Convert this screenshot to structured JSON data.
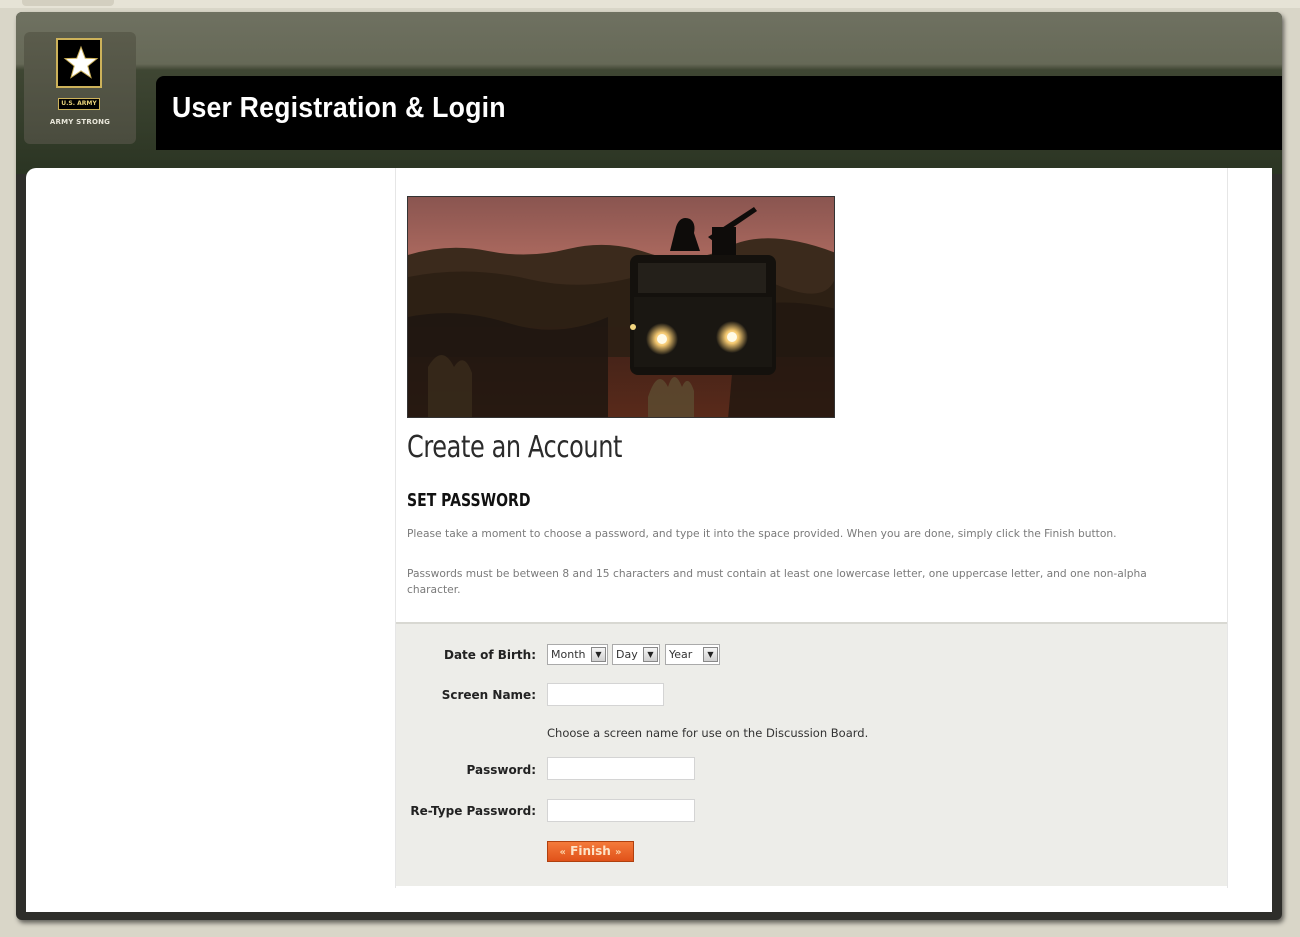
{
  "header": {
    "logo_tag": "U.S. ARMY",
    "logo_slogan": "ARMY STRONG",
    "title": "User Registration & Login"
  },
  "main": {
    "hero_image": "soldier-on-vehicle-at-dusk",
    "heading": "Create an Account",
    "section_title": "SET PASSWORD",
    "description_1": "Please take a moment to choose a password, and type it into the space provided. When you are done, simply click the Finish button.",
    "description_2": "Passwords must be between 8 and 15 characters and must contain at least one lowercase letter, one uppercase letter, and one non-alpha character."
  },
  "form": {
    "dob_label": "Date of Birth:",
    "dob_month": "Month",
    "dob_day": "Day",
    "dob_year": "Year",
    "screen_name_label": "Screen Name:",
    "screen_name_value": "",
    "screen_name_hint": "Choose a screen name for use on the Discussion Board.",
    "password_label": "Password:",
    "password_value": "",
    "retype_label": "Re-Type Password:",
    "retype_value": "",
    "finish_label": "Finish"
  },
  "colors": {
    "accent_orange": "#e8602a",
    "header_black": "#000000",
    "frame_dark": "#2e2e2a"
  }
}
